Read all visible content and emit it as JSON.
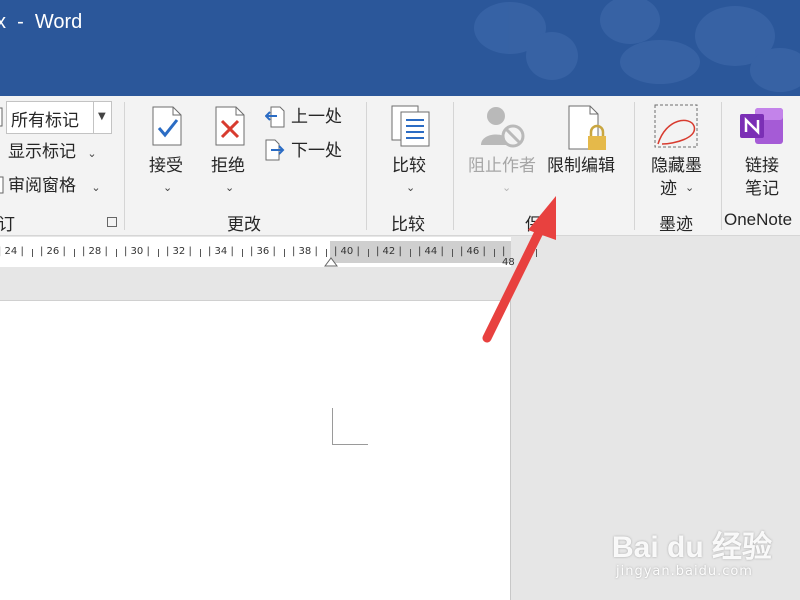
{
  "window": {
    "title": "x  -  Word"
  },
  "ribbon": {
    "tracking": {
      "markup_dropdown_value": "所有标记",
      "show_markup": "显示标记",
      "reviewing_pane": "审阅窗格",
      "group_label": "订"
    },
    "changes": {
      "accept": "接受",
      "reject": "拒绝",
      "previous": "上一处",
      "next": "下一处",
      "group_label": "更改"
    },
    "compare": {
      "compare": "比较",
      "group_label": "比较"
    },
    "protect": {
      "block_authors": "阻止作者",
      "restrict_editing": "限制编辑",
      "group_label": "保"
    },
    "ink": {
      "hide_ink_line1": "隐藏墨",
      "hide_ink_line2": "迹",
      "group_label": "墨迹"
    },
    "onenote": {
      "linked_notes_line1": "链接",
      "linked_notes_line2": "笔记",
      "group_label": "OneNote"
    }
  },
  "ruler": {
    "ticks": [
      "24",
      "26",
      "28",
      "30",
      "32",
      "34",
      "36",
      "38",
      "40",
      "42",
      "44",
      "46",
      "48"
    ]
  },
  "watermark": {
    "logo": "Bai du 经验",
    "url": "jingyan.baidu.com"
  },
  "colors": {
    "title_bar": "#2b579a",
    "ribbon": "#f3f3f3",
    "arrow": "#e8413f",
    "onenote": "#7b2fb5"
  }
}
